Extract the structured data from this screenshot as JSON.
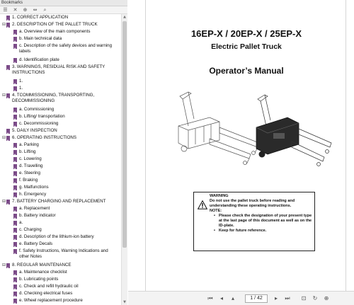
{
  "panel": {
    "header_title": "Bookmarks",
    "toolbar_icons": [
      "options-icon",
      "delete-icon",
      "new-bookmark-icon",
      "expand-icon",
      "find-icon"
    ]
  },
  "bookmarks": [
    {
      "expander": "",
      "label": "1. CORRECT APPLICATION"
    },
    {
      "expander": "⊟",
      "label": "2.  DESCRIPTION OF THE PALLET TRUCK"
    },
    {
      "expander": "",
      "label": "a.  Overview of the main components"
    },
    {
      "expander": "",
      "label": "b.  Main technical data"
    },
    {
      "expander": "",
      "label": "c. Description of the safety devices and warning labels"
    },
    {
      "expander": "",
      "label": "d. Identification plate"
    },
    {
      "expander": "",
      "label": "3. WARNINGS, RESIDUAL RISK AND SAFETY INSTRUCTIONS"
    },
    {
      "expander": "",
      "label": "1."
    },
    {
      "expander": "",
      "label": "1."
    },
    {
      "expander": "⊟",
      "label": "4. TCOMMISSIONING, TRANSPORTING, DECOMMISSIONING"
    },
    {
      "expander": "",
      "label": "a.  Commissioning"
    },
    {
      "expander": "",
      "label": "b.  Lifting/ transportation"
    },
    {
      "expander": "",
      "label": "c.  Decommissioning"
    },
    {
      "expander": "",
      "label": "5. DAILY INSPECTION"
    },
    {
      "expander": "⊟",
      "label": "6. OPERATING INSTRUCTIONS"
    },
    {
      "expander": "",
      "label": "a.  Parking"
    },
    {
      "expander": "",
      "label": "b.  Lifting"
    },
    {
      "expander": "",
      "label": "c.  Lowering"
    },
    {
      "expander": "",
      "label": "d.  Travelling"
    },
    {
      "expander": "",
      "label": "e.  Steering"
    },
    {
      "expander": "",
      "label": "f.  Braking"
    },
    {
      "expander": "",
      "label": "g.  Malfunctions"
    },
    {
      "expander": "",
      "label": "h.  Emergency"
    },
    {
      "expander": "⊟",
      "label": "7. BATTERY CHARGING AND REPLACEMENT"
    },
    {
      "expander": "",
      "label": "a.  Replacement"
    },
    {
      "expander": "",
      "label": "b.  Battery indicator"
    },
    {
      "expander": "",
      "label": "a."
    },
    {
      "expander": "",
      "label": "c.  Charging"
    },
    {
      "expander": "",
      "label": "d.  Description of the lithium-ion battery"
    },
    {
      "expander": "",
      "label": "e. Battery Decals"
    },
    {
      "expander": "",
      "label": "f. Safety Instructions, Warning Indications and other Notes"
    },
    {
      "expander": "⊟",
      "label": "8. REGULAR MAINTENANCE"
    },
    {
      "expander": "",
      "label": "a.  Maintenance checklist"
    },
    {
      "expander": "",
      "label": "b.  Lubricating points"
    },
    {
      "expander": "",
      "label": "c.  Check and refill hydraulic oil"
    },
    {
      "expander": "",
      "label": "d.  Checking electrical fuses"
    },
    {
      "expander": "",
      "label": "e. Wheel replacement procedure"
    }
  ],
  "document": {
    "title": "16EP-X / 20EP-X / 25EP-X",
    "subtitle": "Electric Pallet Truck",
    "manual": "Operator’s Manual",
    "warning": {
      "heading": "WARNING",
      "line1": "Do not use the pallet truck before reading and understanding these operating instructions.",
      "note": "NOTE:",
      "bullet1": "Please check the designation of your present type at the last page of this document as well as on the ID-plate.",
      "bullet2": "Keep for future reference."
    }
  },
  "pager": {
    "page_display": "1 / 42",
    "icons": [
      "first-page-icon",
      "previous-page-icon",
      "next-page-icon",
      "last-page-icon",
      "rotate-icon"
    ]
  },
  "colors": {
    "bookmark_flag": "#7b4b88",
    "panel_border": "#c9c9c9",
    "toolbar_bg": "#f3f3f3"
  }
}
